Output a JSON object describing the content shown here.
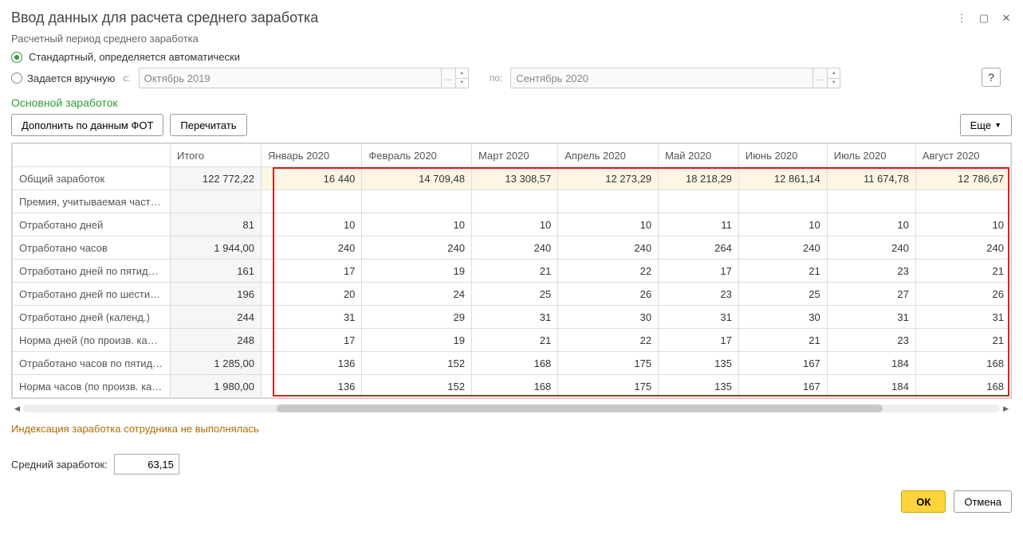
{
  "title": "Ввод данных для расчета среднего заработка",
  "subtitle": "Расчетный период среднего заработка",
  "help_label": "?",
  "radio_auto": "Стандартный, определяется автоматически",
  "radio_manual": "Задается вручную",
  "manual_from_lbl": "с:",
  "manual_to_lbl": "по:",
  "date_from": "Октябрь 2019",
  "date_to": "Сентябрь 2020",
  "section": "Основной заработок",
  "btn_fill": "Дополнить по данным ФОТ",
  "btn_reread": "Перечитать",
  "btn_more": "Еще",
  "columns": {
    "label": "",
    "total": "Итого",
    "months": [
      "Январь 2020",
      "Февраль 2020",
      "Март 2020",
      "Апрель 2020",
      "Май 2020",
      "Июнь 2020",
      "Июль 2020",
      "Август 2020"
    ]
  },
  "rows": [
    {
      "label": "Общий заработок",
      "total": "122 772,22",
      "vals": [
        "16 440",
        "14 709,48",
        "13 308,57",
        "12 273,29",
        "18 218,29",
        "12 861,14",
        "11 674,78",
        "12 786,67"
      ],
      "earn": true
    },
    {
      "label": "Премия, учитываемая частично",
      "total": "",
      "vals": [
        "",
        "",
        "",
        "",
        "",
        "",
        "",
        ""
      ]
    },
    {
      "label": "Отработано дней",
      "total": "81",
      "vals": [
        "10",
        "10",
        "10",
        "10",
        "11",
        "10",
        "10",
        "10"
      ]
    },
    {
      "label": "Отработано часов",
      "total": "1 944,00",
      "vals": [
        "240",
        "240",
        "240",
        "240",
        "264",
        "240",
        "240",
        "240"
      ]
    },
    {
      "label": "Отработано дней по пятидневной ...",
      "total": "161",
      "vals": [
        "17",
        "19",
        "21",
        "22",
        "17",
        "21",
        "23",
        "21"
      ]
    },
    {
      "label": "Отработано дней по шестидневно...",
      "total": "196",
      "vals": [
        "20",
        "24",
        "25",
        "26",
        "23",
        "25",
        "27",
        "26"
      ]
    },
    {
      "label": "Отработано дней (календ.)",
      "total": "244",
      "vals": [
        "31",
        "29",
        "31",
        "30",
        "31",
        "30",
        "31",
        "31"
      ]
    },
    {
      "label": "Норма дней (по произв. календар...",
      "total": "248",
      "vals": [
        "17",
        "19",
        "21",
        "22",
        "17",
        "21",
        "23",
        "21"
      ]
    },
    {
      "label": "Отработано часов по пятидневно...",
      "total": "1 285,00",
      "vals": [
        "136",
        "152",
        "168",
        "175",
        "135",
        "167",
        "184",
        "168"
      ]
    },
    {
      "label": "Норма часов (по произв. календа...",
      "total": "1 980,00",
      "vals": [
        "136",
        "152",
        "168",
        "175",
        "135",
        "167",
        "184",
        "168"
      ]
    }
  ],
  "status": "Индексация заработка сотрудника не выполнялась",
  "avg_label": "Средний заработок:",
  "avg_value": "63,15",
  "btn_ok": "ОК",
  "btn_cancel": "Отмена"
}
